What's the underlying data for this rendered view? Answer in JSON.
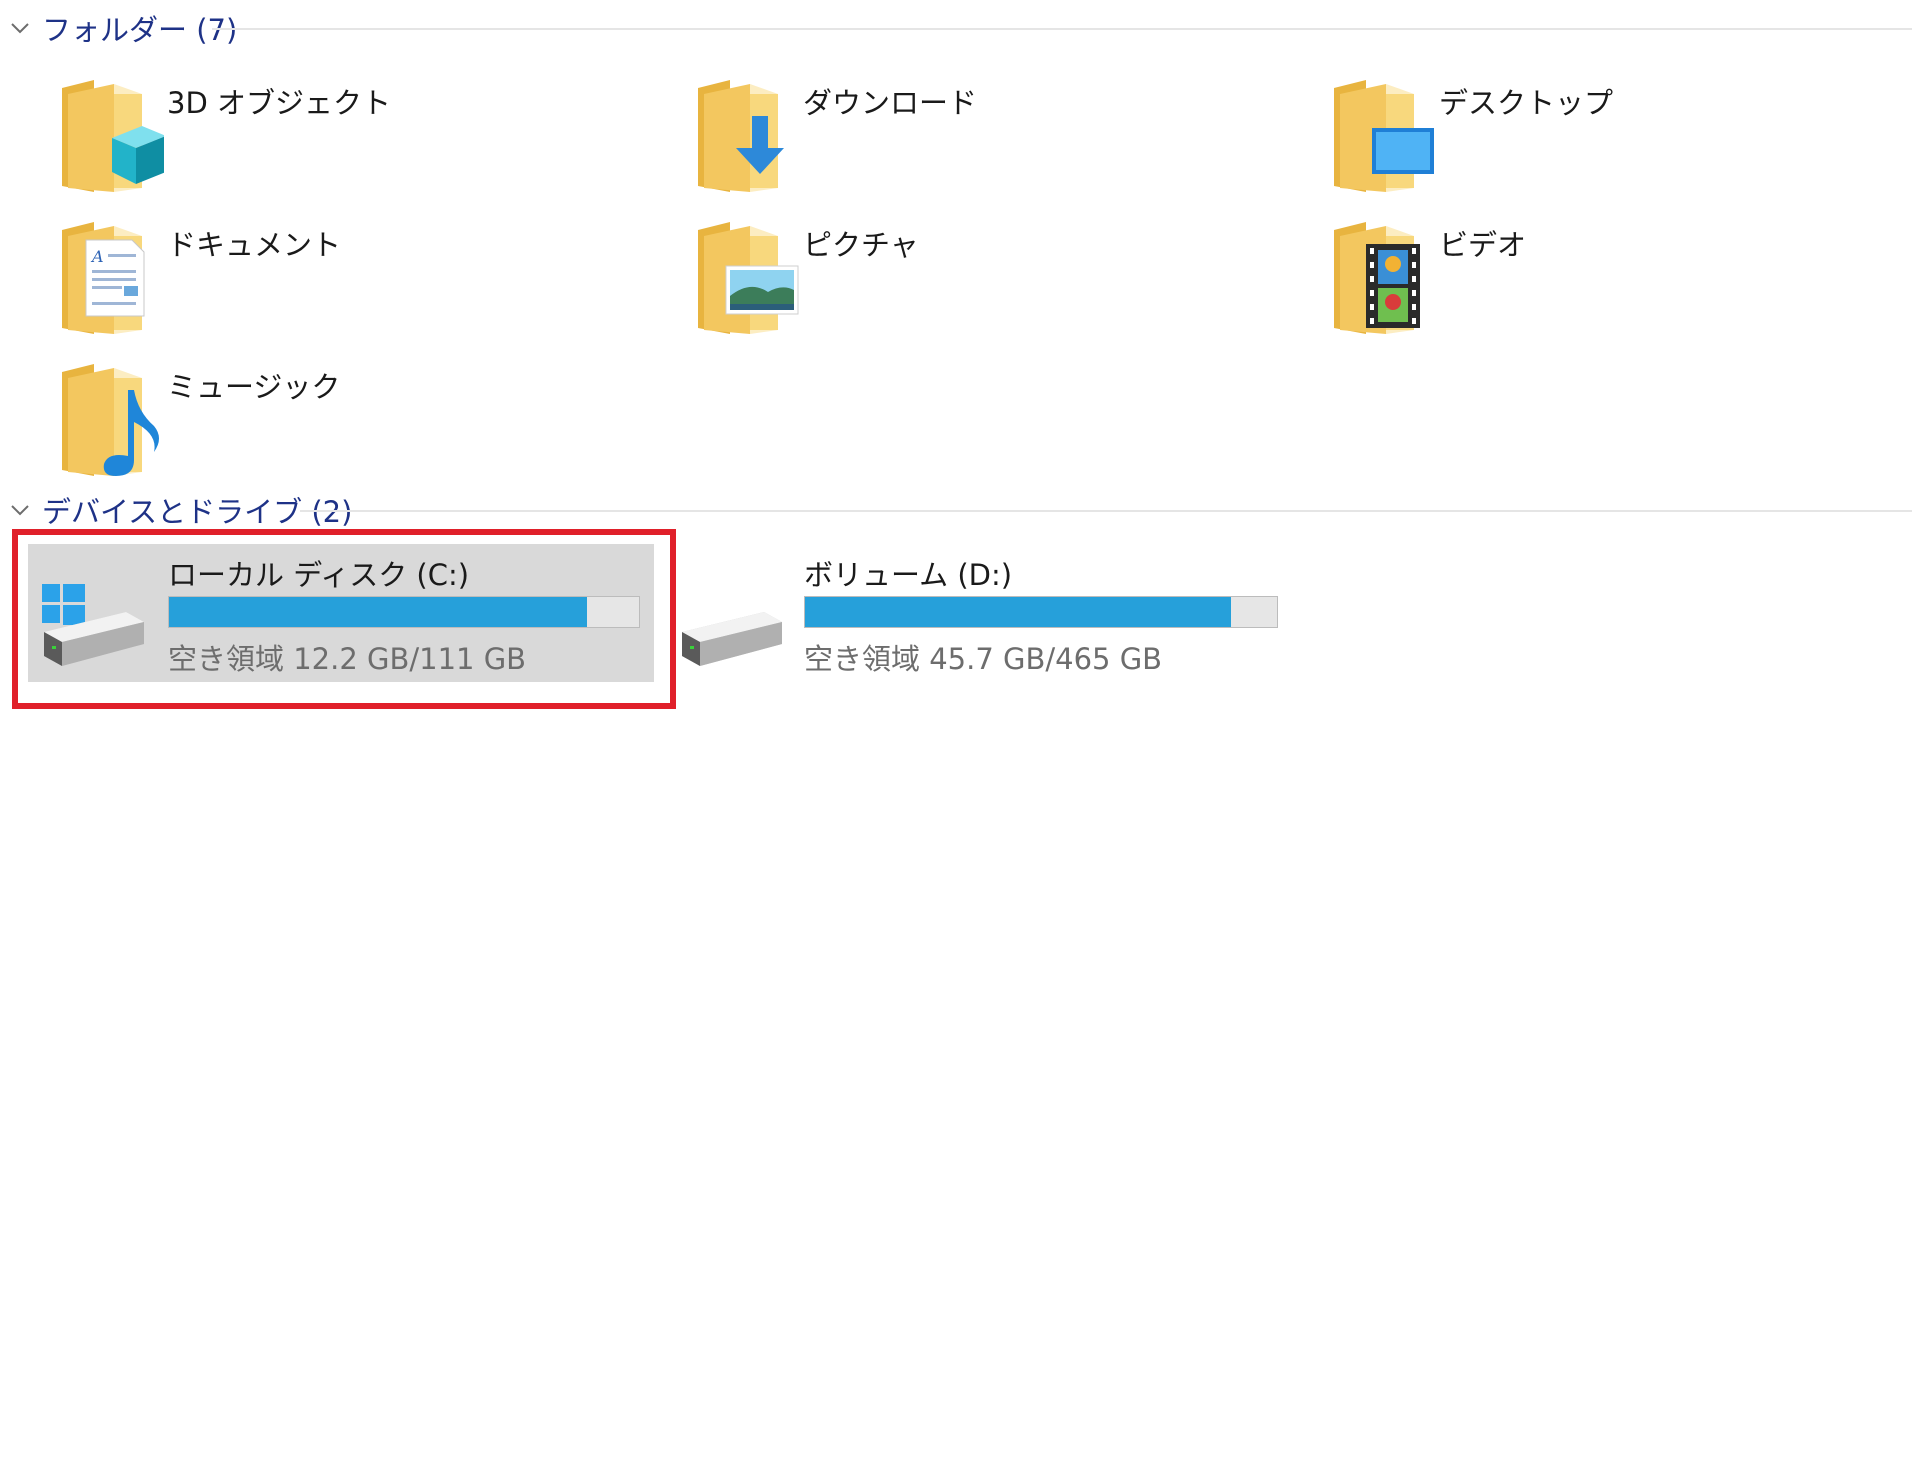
{
  "groups": {
    "folders": {
      "title": "フォルダー (7)"
    },
    "devices": {
      "title": "デバイスとドライブ (2)"
    }
  },
  "folders": [
    {
      "label": "3D オブジェクト",
      "icon": "3d-objects-icon"
    },
    {
      "label": "ダウンロード",
      "icon": "downloads-icon"
    },
    {
      "label": "デスクトップ",
      "icon": "desktop-icon"
    },
    {
      "label": "ドキュメント",
      "icon": "documents-icon"
    },
    {
      "label": "ピクチャ",
      "icon": "pictures-icon"
    },
    {
      "label": "ビデオ",
      "icon": "videos-icon"
    },
    {
      "label": "ミュージック",
      "icon": "music-icon"
    }
  ],
  "drives": [
    {
      "name": "ローカル ディスク (C:)",
      "free": "空き領域 12.2 GB/111 GB",
      "used_fraction": 0.89,
      "selected": true,
      "icon": "windows-drive-icon"
    },
    {
      "name": "ボリューム (D:)",
      "free": "空き領域 45.7 GB/465 GB",
      "used_fraction": 0.902,
      "selected": false,
      "icon": "drive-icon"
    }
  ],
  "colors": {
    "group_header": "#1e3287",
    "bar_fill": "#26a0da",
    "selection": "#d9d9d9",
    "highlight_border": "#e0202a",
    "folder_yellow": "#f3c75f"
  }
}
